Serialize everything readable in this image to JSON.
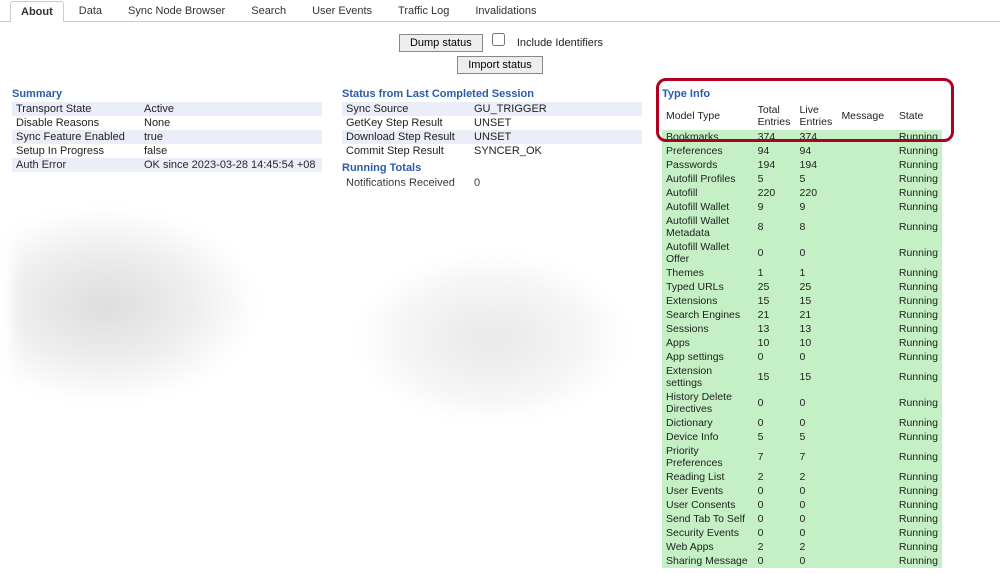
{
  "tabs": [
    "About",
    "Data",
    "Sync Node Browser",
    "Search",
    "User Events",
    "Traffic Log",
    "Invalidations"
  ],
  "active_tab_index": 0,
  "toolbar": {
    "dump_label": "Dump status",
    "include_identifiers_label": "Include Identifiers",
    "import_label": "Import status"
  },
  "summary": {
    "title": "Summary",
    "rows": [
      {
        "k": "Transport State",
        "v": "Active"
      },
      {
        "k": "Disable Reasons",
        "v": "None"
      },
      {
        "k": "Sync Feature Enabled",
        "v": "true"
      },
      {
        "k": "Setup In Progress",
        "v": "false"
      },
      {
        "k": "Auth Error",
        "v": "OK since 2023-03-28 14:45:54 +08"
      }
    ]
  },
  "last_session": {
    "title": "Status from Last Completed Session",
    "rows": [
      {
        "k": "Sync Source",
        "v": "GU_TRIGGER"
      },
      {
        "k": "GetKey Step Result",
        "v": "UNSET"
      },
      {
        "k": "Download Step Result",
        "v": "UNSET"
      },
      {
        "k": "Commit Step Result",
        "v": "SYNCER_OK"
      }
    ]
  },
  "running_totals": {
    "title": "Running Totals",
    "rows": [
      {
        "k": "Notifications Received",
        "v": "0"
      }
    ]
  },
  "type_info": {
    "title": "Type Info",
    "headers": [
      "Model Type",
      "Total Entries",
      "Live Entries",
      "Message",
      "State"
    ],
    "rows": [
      {
        "name": "Bookmarks",
        "total": "374",
        "live": "374",
        "msg": "",
        "state": "Running"
      },
      {
        "name": "Preferences",
        "total": "94",
        "live": "94",
        "msg": "",
        "state": "Running"
      },
      {
        "name": "Passwords",
        "total": "194",
        "live": "194",
        "msg": "",
        "state": "Running"
      },
      {
        "name": "Autofill Profiles",
        "total": "5",
        "live": "5",
        "msg": "",
        "state": "Running"
      },
      {
        "name": "Autofill",
        "total": "220",
        "live": "220",
        "msg": "",
        "state": "Running"
      },
      {
        "name": "Autofill Wallet",
        "total": "9",
        "live": "9",
        "msg": "",
        "state": "Running"
      },
      {
        "name": "Autofill Wallet Metadata",
        "total": "8",
        "live": "8",
        "msg": "",
        "state": "Running"
      },
      {
        "name": "Autofill Wallet Offer",
        "total": "0",
        "live": "0",
        "msg": "",
        "state": "Running"
      },
      {
        "name": "Themes",
        "total": "1",
        "live": "1",
        "msg": "",
        "state": "Running"
      },
      {
        "name": "Typed URLs",
        "total": "25",
        "live": "25",
        "msg": "",
        "state": "Running"
      },
      {
        "name": "Extensions",
        "total": "15",
        "live": "15",
        "msg": "",
        "state": "Running"
      },
      {
        "name": "Search Engines",
        "total": "21",
        "live": "21",
        "msg": "",
        "state": "Running"
      },
      {
        "name": "Sessions",
        "total": "13",
        "live": "13",
        "msg": "",
        "state": "Running"
      },
      {
        "name": "Apps",
        "total": "10",
        "live": "10",
        "msg": "",
        "state": "Running"
      },
      {
        "name": "App settings",
        "total": "0",
        "live": "0",
        "msg": "",
        "state": "Running"
      },
      {
        "name": "Extension settings",
        "total": "15",
        "live": "15",
        "msg": "",
        "state": "Running"
      },
      {
        "name": "History Delete Directives",
        "total": "0",
        "live": "0",
        "msg": "",
        "state": "Running"
      },
      {
        "name": "Dictionary",
        "total": "0",
        "live": "0",
        "msg": "",
        "state": "Running"
      },
      {
        "name": "Device Info",
        "total": "5",
        "live": "5",
        "msg": "",
        "state": "Running"
      },
      {
        "name": "Priority Preferences",
        "total": "7",
        "live": "7",
        "msg": "",
        "state": "Running"
      },
      {
        "name": "Reading List",
        "total": "2",
        "live": "2",
        "msg": "",
        "state": "Running"
      },
      {
        "name": "User Events",
        "total": "0",
        "live": "0",
        "msg": "",
        "state": "Running"
      },
      {
        "name": "User Consents",
        "total": "0",
        "live": "0",
        "msg": "",
        "state": "Running"
      },
      {
        "name": "Send Tab To Self",
        "total": "0",
        "live": "0",
        "msg": "",
        "state": "Running"
      },
      {
        "name": "Security Events",
        "total": "0",
        "live": "0",
        "msg": "",
        "state": "Running"
      },
      {
        "name": "Web Apps",
        "total": "2",
        "live": "2",
        "msg": "",
        "state": "Running"
      },
      {
        "name": "Sharing Message",
        "total": "0",
        "live": "0",
        "msg": "",
        "state": "Running"
      }
    ]
  }
}
